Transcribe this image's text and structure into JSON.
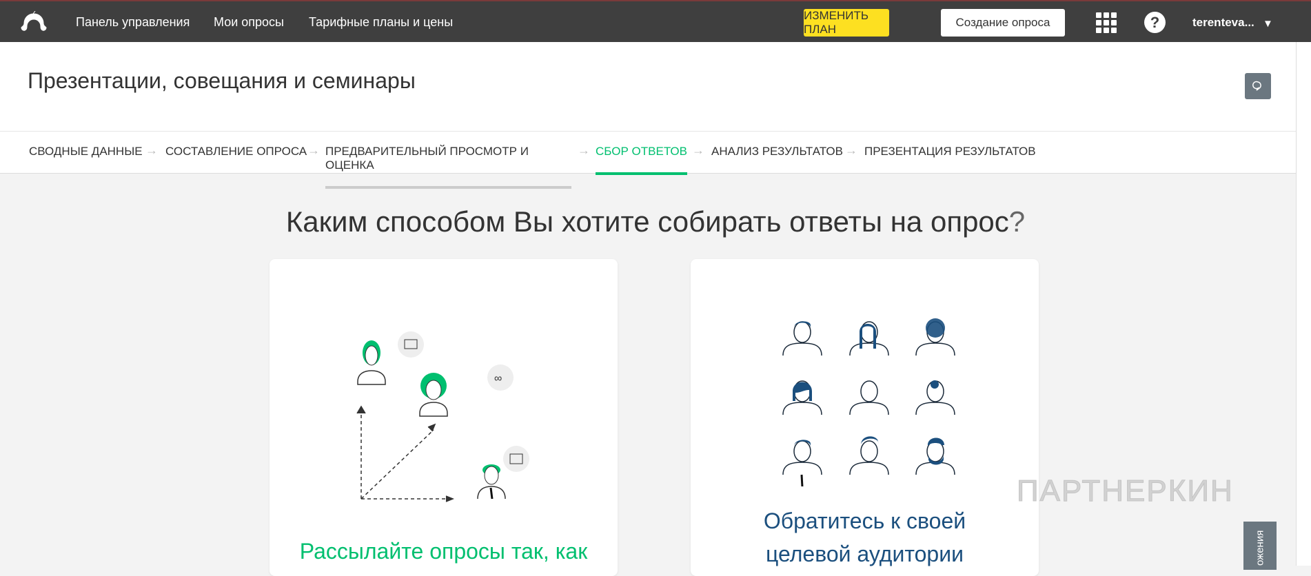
{
  "topbar": {
    "nav": [
      "Панель управления",
      "Мои опросы",
      "Тарифные планы и цены"
    ],
    "upgrade": "ИЗМЕНИТЬ ПЛАН",
    "create": "Создание опроса",
    "help": "?",
    "user": "terenteva...",
    "caret": "▼"
  },
  "header": {
    "title": "Презентации, совещания и семинары"
  },
  "steps": [
    "СВОДНЫЕ ДАННЫЕ",
    "СОСТАВЛЕНИЕ ОПРОСА",
    "ПРЕДВАРИТЕЛЬНЫЙ ПРОСМОТР И ОЦЕНКА",
    "СБОР ОТВЕТОВ",
    "АНАЛИЗ РЕЗУЛЬТАТОВ",
    "ПРЕЗЕНТАЦИЯ РЕЗУЛЬТАТОВ"
  ],
  "main": {
    "question": "Каким способом Вы хотите собирать ответы на опрос",
    "qmark": "?",
    "card1": "Рассылайте опросы так, как",
    "card2_line1": "Обратитесь к своей",
    "card2_line2": "целевой аудитории"
  },
  "watermark": "ПАРТНЕРКИН",
  "side_tab": "ожения",
  "colors": {
    "accent": "#00bf6f",
    "yellow": "#fde021",
    "navy": "#1b4f7e"
  }
}
